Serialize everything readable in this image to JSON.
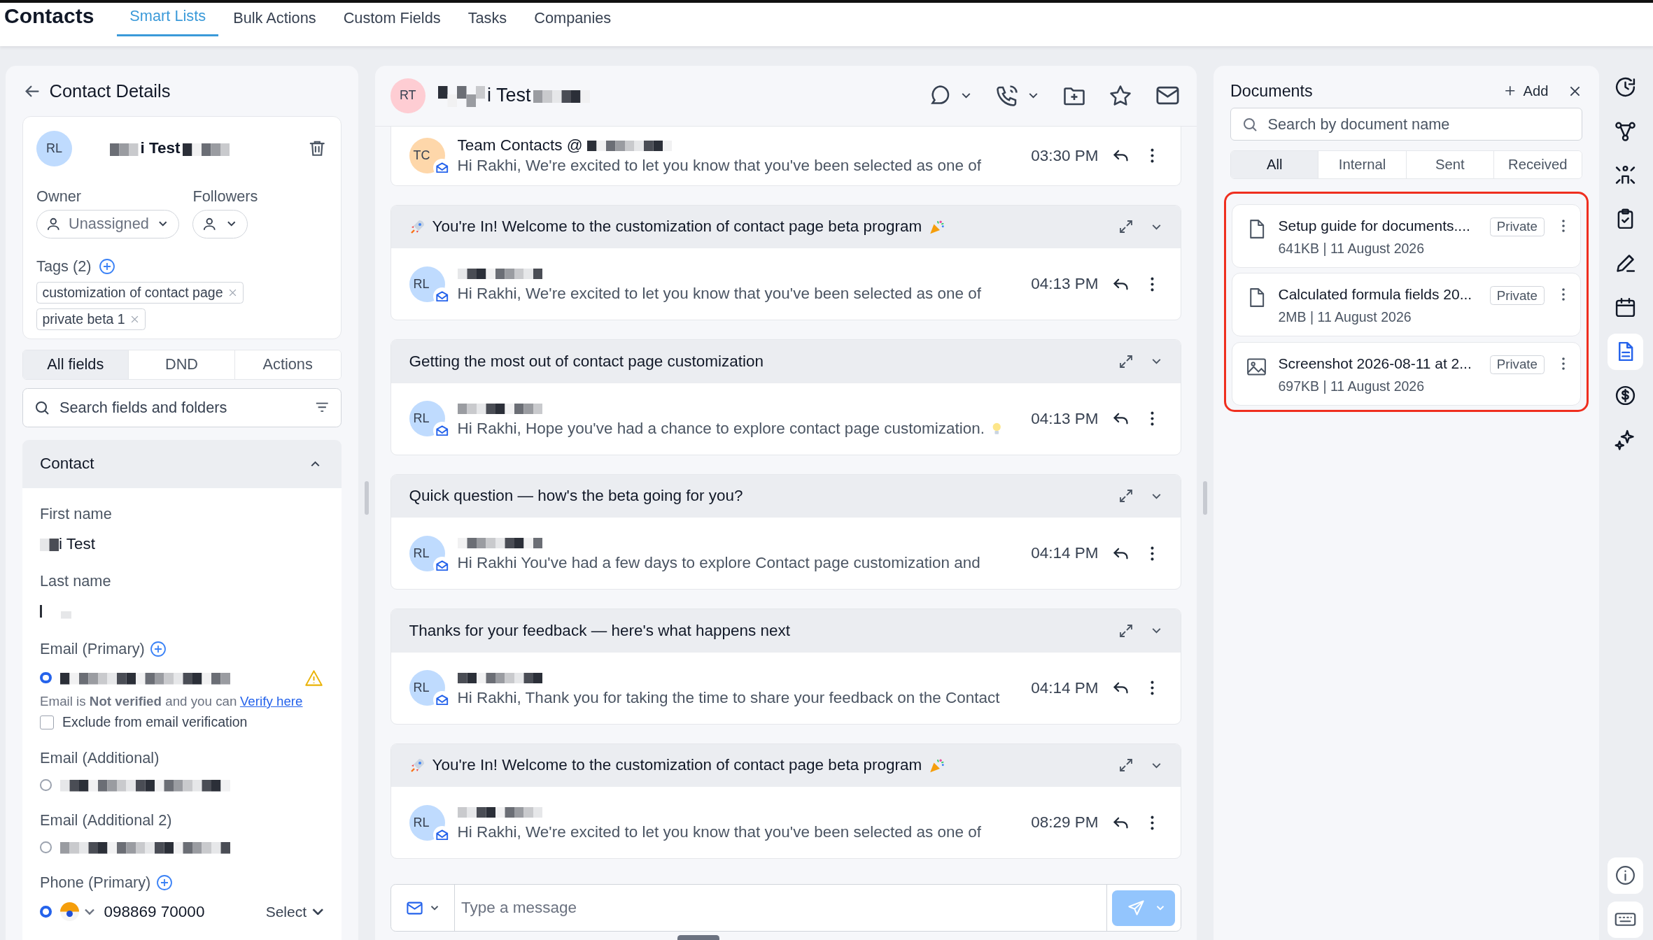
{
  "top_nav": {
    "title": "Contacts",
    "tabs": [
      {
        "label": "Smart Lists",
        "selected": true
      },
      {
        "label": "Bulk Actions",
        "selected": false
      },
      {
        "label": "Custom Fields",
        "selected": false
      },
      {
        "label": "Tasks",
        "selected": false
      },
      {
        "label": "Companies",
        "selected": false
      }
    ]
  },
  "contact_panel": {
    "title": "Contact Details",
    "avatar": "RL",
    "name": "i Test",
    "owner_label": "Owner",
    "owner_value": "Unassigned",
    "followers_label": "Followers",
    "tags_label": "Tags (2)",
    "tags": [
      "customization of contact page",
      "private beta 1"
    ],
    "field_tabs": [
      {
        "label": "All fields",
        "selected": true
      },
      {
        "label": "DND",
        "selected": false
      },
      {
        "label": "Actions",
        "selected": false
      }
    ],
    "search_placeholder": "Search fields and folders",
    "section": {
      "title": "Contact",
      "expanded": true
    },
    "fields": [
      {
        "kind": "text",
        "label": "First name",
        "value": "i Test"
      },
      {
        "kind": "text",
        "label": "Last name"
      },
      {
        "kind": "email",
        "label": "Email (Primary)",
        "addable": true,
        "selected": true,
        "warning": true,
        "note": "Email is **Not verified** and you can",
        "link": "Verify here",
        "checkbox": {
          "label": "Exclude from email verification",
          "checked": false
        }
      },
      {
        "kind": "email",
        "label": "Email (Additional)",
        "selected": false
      },
      {
        "kind": "email",
        "label": "Email (Additional 2)",
        "selected": false
      },
      {
        "kind": "phone",
        "label": "Phone (Primary)",
        "addable": true,
        "selected": true,
        "value": "098869 70000",
        "select": "Select"
      }
    ]
  },
  "conversation": {
    "avatar": "RT",
    "name": "i Test",
    "threads": [
      {
        "avatar": "TC",
        "color": "#fed7aa",
        "sender": "Team Contacts @",
        "preview": "Hi Rakhi, We're excited to let you know that you've been selected as one of",
        "time": "03:30 PM"
      },
      {
        "subject": "You're In! Welcome to the customization of contact page beta program",
        "decorated": true,
        "avatar": "RL",
        "color": "#bfdbfe",
        "preview": "Hi Rakhi, We're excited to let you know that you've been selected as one of",
        "time": "04:13 PM"
      },
      {
        "subject": "Getting the most out of contact page customization",
        "avatar": "RL",
        "color": "#bfdbfe",
        "preview": "Hi Rakhi, Hope you've had a chance to explore contact page customization.",
        "bulb": true,
        "time": "04:13 PM"
      },
      {
        "subject": "Quick question — how's the beta going for you?",
        "avatar": "RL",
        "color": "#bfdbfe",
        "preview": "Hi Rakhi You've had a few days to explore Contact page customization and",
        "time": "04:14 PM"
      },
      {
        "subject": "Thanks for your feedback — here's what happens next",
        "avatar": "RL",
        "color": "#bfdbfe",
        "preview": "Hi Rakhi, Thank you for taking the time to share your feedback on the Contact",
        "time": "04:14 PM"
      },
      {
        "subject": "You're In! Welcome to the customization of contact page beta program",
        "decorated": true,
        "avatar": "RL",
        "color": "#bfdbfe",
        "preview": "Hi Rakhi, We're excited to let you know that you've been selected as one of",
        "time": "08:29 PM"
      }
    ],
    "composer_placeholder": "Type a message"
  },
  "documents": {
    "title": "Documents",
    "add_label": "Add",
    "search_placeholder": "Search by document name",
    "filters": [
      {
        "label": "All",
        "selected": true
      },
      {
        "label": "Internal",
        "selected": false
      },
      {
        "label": "Sent",
        "selected": false
      },
      {
        "label": "Received",
        "selected": false
      }
    ],
    "highlighted": true,
    "items": [
      {
        "kind": "file",
        "name": "Setup guide for documents....",
        "meta": "641KB | 11 August 2026",
        "badge": "Private"
      },
      {
        "kind": "file",
        "name": "Calculated formula fields 20...",
        "meta": "2MB | 11 August 2026",
        "badge": "Private"
      },
      {
        "kind": "image",
        "name": "Screenshot 2026-08-11 at 2...",
        "meta": "697KB | 11 August 2026",
        "badge": "Private"
      }
    ]
  },
  "rail": [
    {
      "kind": "history",
      "selected": false
    },
    {
      "kind": "workflow",
      "selected": false
    },
    {
      "kind": "people",
      "selected": false
    },
    {
      "kind": "tasks",
      "selected": false
    },
    {
      "kind": "notes",
      "selected": false
    },
    {
      "kind": "calendar",
      "selected": false
    },
    {
      "kind": "documents",
      "selected": true
    },
    {
      "kind": "payments",
      "selected": false
    },
    {
      "kind": "ai",
      "selected": false
    }
  ],
  "rail_bottom": [
    {
      "kind": "info"
    },
    {
      "kind": "keyboard"
    }
  ]
}
